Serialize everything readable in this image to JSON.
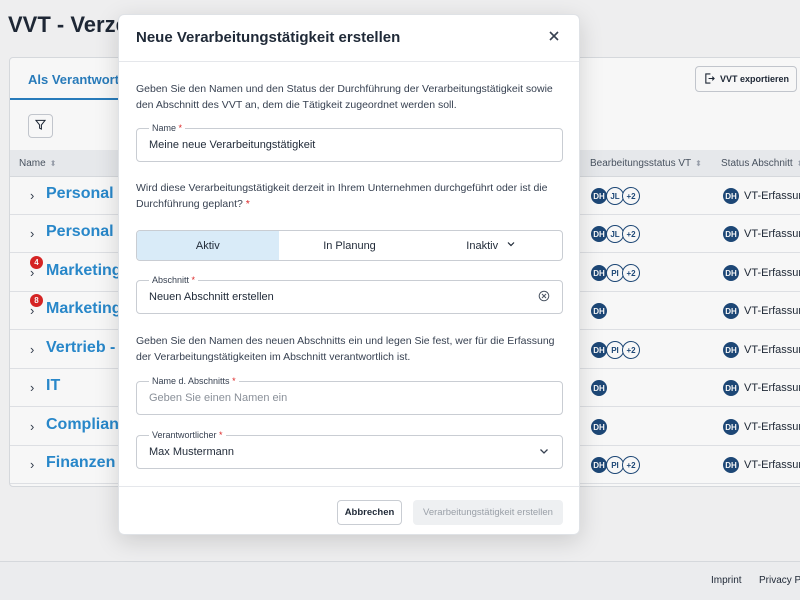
{
  "page": {
    "title": "VVT - Verze",
    "tab_active": "Als Verantwortlic",
    "export_label": "VVT exportieren",
    "columns": {
      "name": "Name",
      "bearbeitungsstatus": "Bearbeitungsstatus VT",
      "status_abschnitt": "Status Abschnitt"
    },
    "rows": [
      {
        "label": "Personal -",
        "badge": "",
        "avatars": [
          "DH",
          "JL",
          "+2"
        ],
        "status_avatar": "DH",
        "status": "VT-Erfassun"
      },
      {
        "label": "Personal -",
        "badge": "",
        "avatars": [
          "DH",
          "JL",
          "+2"
        ],
        "status_avatar": "DH",
        "status": "VT-Erfassun"
      },
      {
        "label": "Marketing",
        "badge": "4",
        "avatars": [
          "DH",
          "PI",
          "+2"
        ],
        "status_avatar": "DH",
        "status": "VT-Erfassun"
      },
      {
        "label": "Marketing",
        "badge": "8",
        "avatars": [
          "DH"
        ],
        "status_avatar": "DH",
        "status": "VT-Erfassun"
      },
      {
        "label": "Vertrieb -",
        "badge": "",
        "avatars": [
          "DH",
          "PI",
          "+2"
        ],
        "status_avatar": "DH",
        "status": "VT-Erfassun"
      },
      {
        "label": "IT",
        "badge": "",
        "avatars": [
          "DH"
        ],
        "status_avatar": "DH",
        "status": "VT-Erfassun"
      },
      {
        "label": "Complianc",
        "badge": "",
        "avatars": [
          "DH"
        ],
        "status_avatar": "DH",
        "status": "VT-Erfassun"
      },
      {
        "label": "Finanzen",
        "badge": "",
        "avatars": [
          "DH",
          "PI",
          "+2"
        ],
        "status_avatar": "DH",
        "status": "VT-Erfassun"
      }
    ],
    "footer": {
      "imprint": "Imprint",
      "privacy": "Privacy Po"
    }
  },
  "modal": {
    "title": "Neue Verarbeitungstätigkeit erstellen",
    "intro": "Geben Sie den Namen und den Status der Durchführung der Verarbeitungstätigkeit sowie den Abschnitt des VVT an, dem die Tätigkeit zugeordnet werden soll.",
    "name_label": "Name",
    "name_value": "Meine neue Verarbeitungstätigkeit",
    "question": "Wird diese Verarbeitungstätigkeit derzeit in Ihrem Unternehmen durchgeführt oder ist die Durchführung geplant?",
    "segments": {
      "aktiv": "Aktiv",
      "planung": "In Planung",
      "inaktiv": "Inaktiv"
    },
    "abschnitt_label": "Abschnitt",
    "abschnitt_value": "Neuen Abschnitt erstellen",
    "desc": "Geben Sie den Namen des neuen Abschnitts ein und legen Sie fest, wer für die Erfassung der Verarbeitungstätigkeiten im Abschnitt verantwortlich ist.",
    "abschnitt_name_label": "Name d. Abschnitts",
    "abschnitt_name_placeholder": "Geben Sie einen Namen ein",
    "verantwortlicher_label": "Verantwortlicher",
    "verantwortlicher_value": "Max Mustermann",
    "required_marker": "*",
    "cancel_label": "Abbrechen",
    "create_label": "Verarbeitungstätigkeit erstellen"
  },
  "colors": {
    "accent": "#2a8cd0",
    "avatar": "#1e4a7a",
    "badge": "#dc2626",
    "segment_active": "#d9ebf8"
  },
  "icons": {
    "close": "close-icon",
    "filter": "filter-icon",
    "export": "export-icon",
    "clear": "clear-circle-icon",
    "dropdown": "chevron-down-icon"
  }
}
